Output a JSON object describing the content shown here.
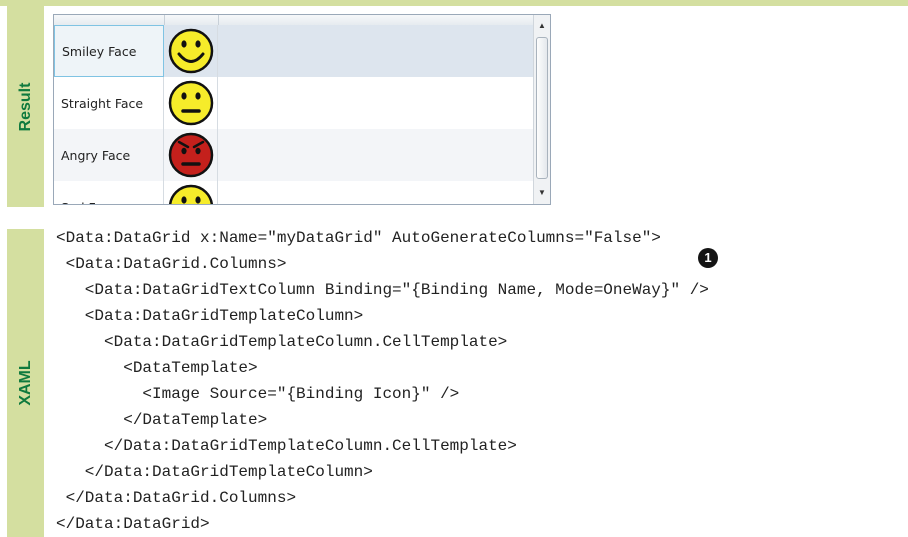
{
  "labels": {
    "result": "Result",
    "xaml": "XAML"
  },
  "grid": {
    "rows": [
      {
        "name": "Smiley Face",
        "icon": "smiley-face-icon",
        "state": "selected"
      },
      {
        "name": "Straight Face",
        "icon": "straight-face-icon",
        "state": "normal"
      },
      {
        "name": "Angry Face",
        "icon": "angry-face-icon",
        "state": "alt"
      },
      {
        "name": "Sad Face",
        "icon": "sad-face-icon",
        "state": "normal"
      }
    ]
  },
  "code": {
    "lines": [
      "<Data:DataGrid x:Name=\"myDataGrid\" AutoGenerateColumns=\"False\">",
      " <Data:DataGrid.Columns>",
      "   <Data:DataGridTextColumn Binding=\"{Binding Name, Mode=OneWay}\" />",
      "   <Data:DataGridTemplateColumn>",
      "     <Data:DataGridTemplateColumn.CellTemplate>",
      "       <DataTemplate>",
      "         <Image Source=\"{Binding Icon}\" />",
      "       </DataTemplate>",
      "     </Data:DataGridTemplateColumn.CellTemplate>",
      "   </Data:DataGridTemplateColumn>",
      " </Data:DataGrid.Columns>",
      "</Data:DataGrid>"
    ],
    "callout": "1"
  },
  "colors": {
    "tab_bg": "#d4dfa0",
    "tab_text": "#0f7a3e",
    "face_yellow": "#f6ec2a",
    "face_red": "#c4201c"
  }
}
